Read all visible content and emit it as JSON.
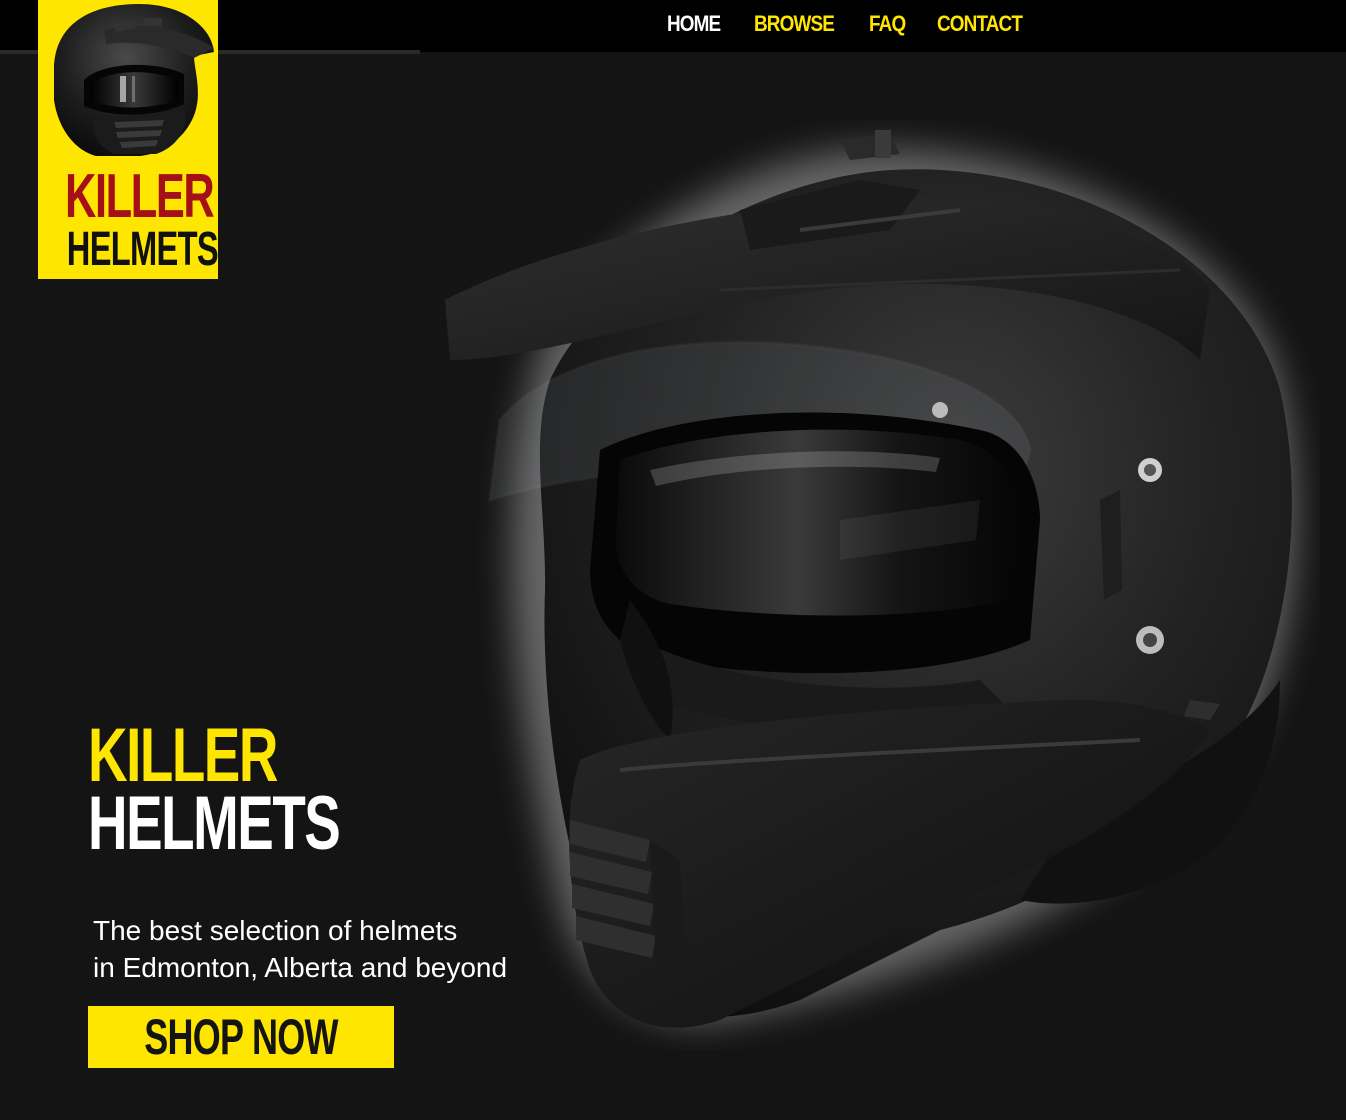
{
  "colors": {
    "accent_yellow": "#ffe600",
    "logo_red": "#a50f17",
    "background": "#141414",
    "nav_bar": "#000000",
    "white": "#ffffff"
  },
  "nav": {
    "items": [
      {
        "label": "HOME",
        "color": "#ffffff",
        "active": true
      },
      {
        "label": "BROWSE",
        "color": "#ffe600",
        "active": false
      },
      {
        "label": "FAQ",
        "color": "#ffe600",
        "active": false
      },
      {
        "label": "CONTACT",
        "color": "#ffe600",
        "active": false
      }
    ]
  },
  "logo": {
    "line1": "KILLER",
    "line2": "HELMETS",
    "icon": "helmet-icon"
  },
  "hero": {
    "headline_line1": "KILLER",
    "headline_line2": "HELMETS",
    "tagline_line1": "The best selection of helmets",
    "tagline_line2": "in Edmonton, Alberta and beyond",
    "cta_label": "SHOP NOW",
    "image": "dual-sport-helmet-photo"
  }
}
